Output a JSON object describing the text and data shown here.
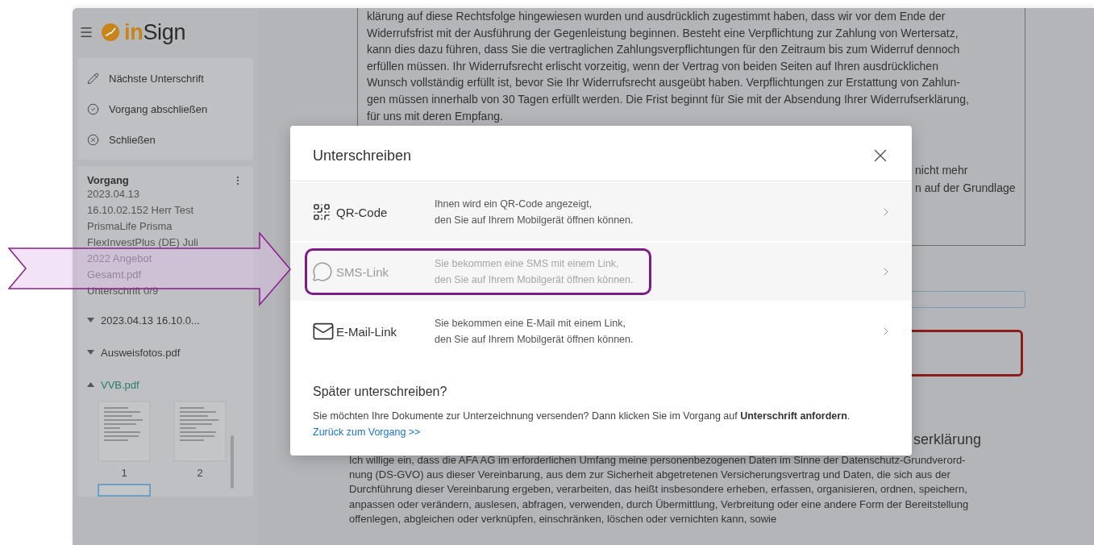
{
  "sidebar": {
    "logo": {
      "prefix": "in",
      "suffix": "Sign"
    },
    "actions": [
      {
        "kind": "pen",
        "label": "Nächste Unterschrift"
      },
      {
        "kind": "check",
        "label": "Vorgang abschließen"
      },
      {
        "kind": "close",
        "label": "Schließen"
      }
    ],
    "process": {
      "heading": "Vorgang",
      "lines": [
        "2023.04.13",
        "16.10.02.152 Herr Test",
        "PrismaLife Prisma",
        "FlexInvestPlus (DE) Juli",
        "2022 Angebot",
        "Gesamt.pdf"
      ],
      "signatures": "Unterschrift 0/9"
    },
    "documents": [
      {
        "label": "2023.04.13 16.10.0...",
        "expanded": false,
        "selected": false
      },
      {
        "label": "Ausweisfotos.pdf",
        "expanded": false,
        "selected": false
      },
      {
        "label": "VVB.pdf",
        "expanded": true,
        "selected": true,
        "pages": [
          {
            "label": "1",
            "selected": false
          },
          {
            "label": "2",
            "selected": false
          },
          {
            "selected": true
          }
        ]
      }
    ]
  },
  "document": {
    "box_lines": [
      "klärung auf diese Rechtsfolge hingewiesen wurden und ausdrücklich zugestimmt haben, dass wir vor dem Ende der",
      "Widerrufsfrist mit der Ausführung der Gegenleistung beginnen. Besteht eine Verpflichtung zur Zahlung von Wertersatz,",
      "kann dies dazu führen, dass Sie die vertraglichen Zahlungsverpflichtungen für den Zeitraum bis zum Widerruf dennoch",
      "erfüllen müssen. Ihr Widerrufsrecht erlischt vorzeitig, wenn der Vertrag von beiden Seiten auf Ihren ausdrücklichen",
      "Wunsch vollständig erfüllt ist, bevor Sie Ihr Widerrufsrecht ausgeübt haben. Verpflichtungen zur Erstattung von Zahlun-",
      "gen müssen innerhalb von 30 Tagen erfüllt werden. Die Frist beginnt für Sie mit der Absendung Ihrer Widerrufserklärung,",
      "für uns mit deren Empfang."
    ],
    "box_fragments": [
      "nicht mehr",
      "n auf der Grundlage"
    ],
    "heading_fragment": "serklärung",
    "paragraph_lines": [
      "Ich willige ein, dass die AFA AG im erforderlichen Umfang meine personenbezogenen Daten im Sinne der Datenschutz-Grundverord-",
      "nung (DS-GVO)  aus dieser Vereinbarung, aus dem zur Sicherheit abgetretenen Versicherungsvertrag und Daten, die sich aus der",
      "Durchführung dieser Vereinbarung ergeben, verarbeiten, das heißt insbesondere erheben, erfassen, organisieren, ordnen, speichern,",
      "anpassen oder verändern, auslesen, abfragen, verwenden, durch Übermittlung, Verbreitung oder eine andere Form der Bereitstellung",
      "offenlegen, abgleichen oder verknüpfen, einschränken, löschen oder vernichten kann, sowie"
    ]
  },
  "dialog": {
    "title": "Unterschreiben",
    "options": [
      {
        "kind": "qr",
        "label": "QR-Code",
        "description_lines": [
          "Ihnen wird ein QR-Code angezeigt,",
          "den Sie auf Ihrem Mobilgerät öffnen können."
        ],
        "disabled": false,
        "highlighted": false
      },
      {
        "kind": "sms",
        "label": "SMS-Link",
        "description_lines": [
          "Sie bekommen eine SMS mit einem Link,",
          "den Sie auf Ihrem Mobilgerät öffnen können."
        ],
        "disabled": true,
        "highlighted": true
      },
      {
        "kind": "email",
        "label": "E-Mail-Link",
        "description_lines": [
          "Sie bekommen eine E-Mail mit einem Link,",
          "den Sie auf Ihrem Mobilgerät öffnen können."
        ],
        "disabled": false,
        "highlighted": false
      }
    ],
    "later": {
      "heading": "Später unterschreiben?",
      "text": "Sie möchten Ihre Dokumente zur Unterzeichnung versenden? Dann klicken Sie im Vorgang auf **Unterschrift anfordern**.",
      "link": "Zurück zum Vorgang >>"
    }
  }
}
